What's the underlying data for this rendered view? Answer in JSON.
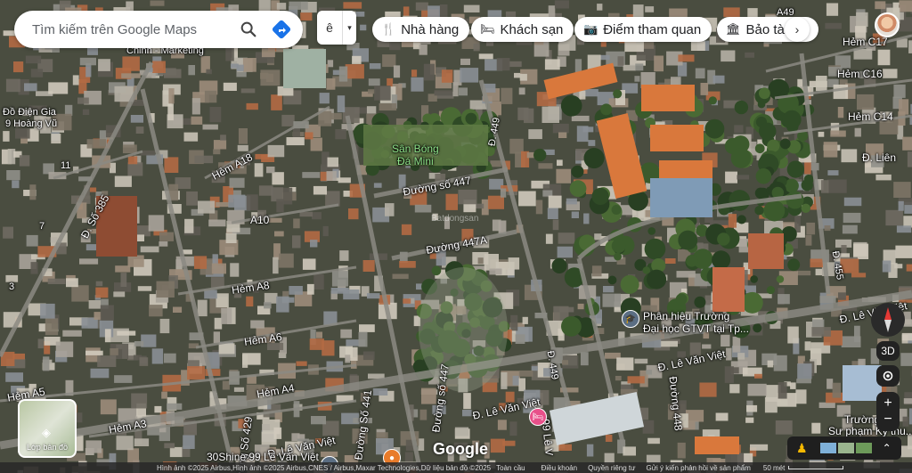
{
  "search": {
    "placeholder": "Tìm kiếm trên Google Maps"
  },
  "layer_select": {
    "label": "ê",
    "caret": "▾"
  },
  "chips": [
    {
      "label": "Nhà hàng",
      "icon": "fork-knife-icon"
    },
    {
      "label": "Khách sạn",
      "icon": "bed-icon"
    },
    {
      "label": "Điểm tham quan",
      "icon": "camera-icon"
    },
    {
      "label": "Bảo tàn",
      "icon": "museum-icon"
    }
  ],
  "chip_more": "›",
  "layers_button": {
    "label": "Lớp bản đồ"
  },
  "controls": {
    "three_d": "3D",
    "zoom_in": "+",
    "zoom_out": "−",
    "expand": "⌃"
  },
  "brand": "Google",
  "map_labels": {
    "chinh_marketing": "Chinh - Marketing",
    "do_dien": "Đồ Điện Gia",
    "hoang_vu": "9 Hoàng Vũ",
    "san_bong": "Sân Bóng",
    "da_mini": "Đá Mini",
    "duong_447": "Đường số 447",
    "duong_447a": "Đường 447A",
    "d_449_top": "Đ. 449",
    "d_449_bottom": "Đ. 449",
    "d_so_385": "Đ. Số 385",
    "num_11": "11",
    "num_7": "7",
    "num_3": "3",
    "hem_a18": "Hẻm A18",
    "a10": "A10",
    "hem_a8": "Hẻm A8",
    "hem_a6": "Hẻm A6",
    "hem_a5": "Hẻm A5",
    "hem_a4": "Hẻm A4",
    "hem_a3": "Hẻm A3",
    "duong_so_441": "Đường Số 441",
    "duong_so_447_v": "Đường số 447",
    "duong_so_429": "Đường Số 429",
    "d_le_van_viet_1": "Đ. Lê Văn Việt",
    "d_le_van_viet_2": "Đ. Lê Văn Việt",
    "d_le_van_viet_3": "Đ. Lê Văn Việt",
    "d_le_van_viet_4": "Đ. Lê Văn Việt",
    "phan_hieu_1": "Phân hiệu Trường",
    "phan_hieu_2": "Đại học GTVT tại Tp...",
    "duong_448": "Đường 448",
    "d_455": "Đ. 455",
    "hem_c17": "Hẻm C17",
    "hem_c16": "Hẻm C16",
    "hem_c14": "Hẻm C14",
    "d_lien": "Đ. Liên",
    "truong_1": "Trường Đ",
    "truong_2": "Sư phạm Kỹ thu...",
    "le_van": "99 Lê V",
    "shine": "30Shine 99 Lê Văn Việt",
    "a49": "A49",
    "watermark": "Batdongsan"
  },
  "footer": {
    "imagery": "Hình ảnh ©2025 Airbus,Hình ảnh ©2025 Airbus,CNES / Airbus,Maxar Technologies,Dữ liệu bản đồ ©2025",
    "country": "Toàn cầu",
    "terms": "Điều khoản",
    "privacy": "Quyền riêng tư",
    "feedback": "Gửi ý kiến phản hồi về sản phẩm",
    "scale": "50 mét"
  },
  "colors": {
    "aerial_base": "#3b3f33",
    "orange_roof": "#d9783c",
    "chip_bg": "#ffffff",
    "control_bg": "#222222",
    "pin_pink": "#e8508a",
    "pin_orange": "#e87b2a"
  }
}
